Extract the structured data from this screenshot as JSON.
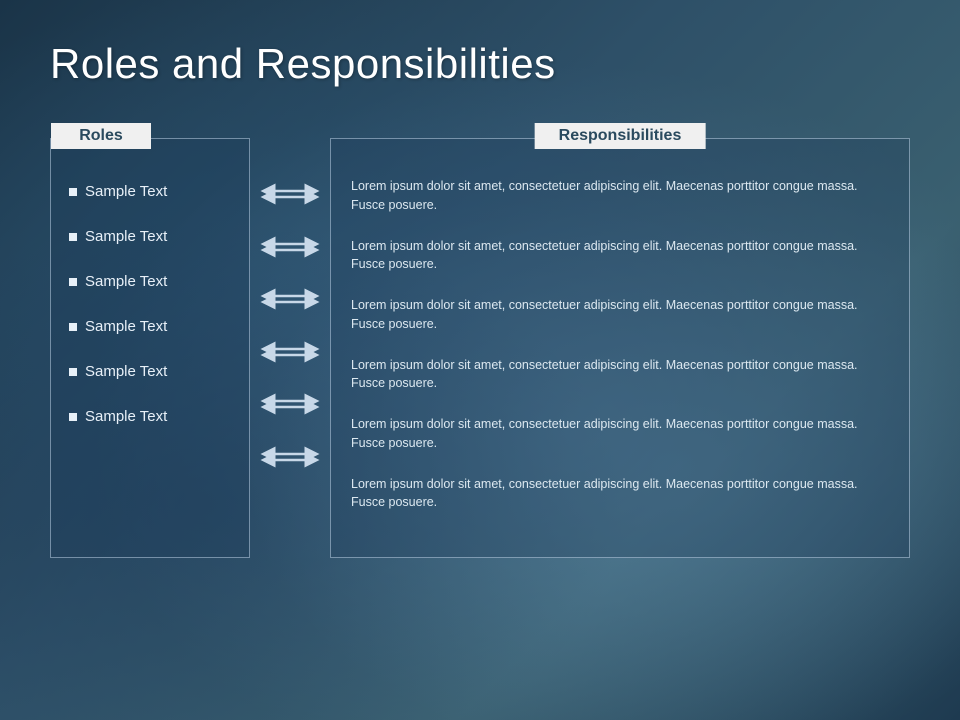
{
  "page": {
    "title": "Roles and Responsibilities"
  },
  "roles_panel": {
    "header": "Roles",
    "items": [
      {
        "label": "Sample Text"
      },
      {
        "label": "Sample Text"
      },
      {
        "label": "Sample Text"
      },
      {
        "label": "Sample Text"
      },
      {
        "label": "Sample Text"
      },
      {
        "label": "Sample Text"
      }
    ]
  },
  "responsibilities_panel": {
    "header": "Responsibilities",
    "items": [
      {
        "text": "Lorem ipsum dolor sit amet, consectetuer adipiscing elit. Maecenas porttitor congue massa. Fusce posuere."
      },
      {
        "text": "Lorem ipsum dolor sit amet, consectetuer adipiscing elit. Maecenas porttitor congue massa. Fusce posuere."
      },
      {
        "text": "Lorem ipsum dolor sit amet, consectetuer adipiscing elit. Maecenas porttitor congue massa. Fusce posuere."
      },
      {
        "text": "Lorem ipsum dolor sit amet, consectetuer adipiscing elit. Maecenas porttitor congue massa. Fusce posuere."
      },
      {
        "text": "Lorem ipsum dolor sit amet, consectetuer adipiscing elit. Maecenas porttitor congue massa. Fusce posuere."
      },
      {
        "text": "Lorem ipsum dolor sit amet, consectetuer adipiscing elit. Maecenas porttitor congue massa. Fusce posuere."
      }
    ]
  },
  "colors": {
    "accent": "#f0f0f0",
    "bg_dark": "#1a3448",
    "text_light": "#e8f0f8"
  }
}
